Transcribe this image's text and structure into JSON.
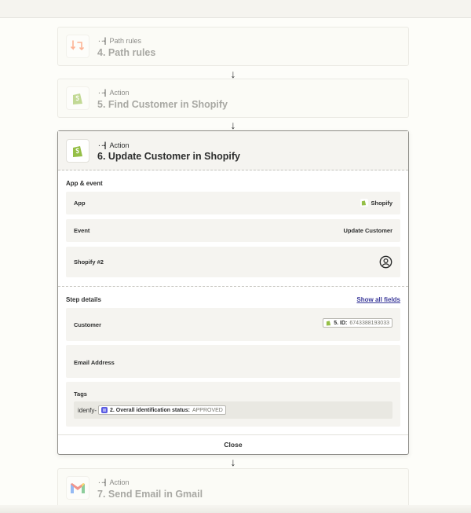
{
  "steps": {
    "path": {
      "kind": "Path rules",
      "title": "4. Path rules"
    },
    "find": {
      "kind": "Action",
      "title": "5. Find Customer in Shopify"
    },
    "update": {
      "kind": "Action",
      "title": "6. Update Customer in Shopify"
    },
    "gmail": {
      "kind": "Action",
      "title": "7. Send Email in Gmail"
    }
  },
  "card": {
    "app_event_label": "App & event",
    "app_label": "App",
    "app_value": "Shopify",
    "event_label": "Event",
    "event_value": "Update Customer",
    "account_label": "Shopify #2",
    "step_details_label": "Step details",
    "show_all_fields": "Show all fields",
    "customer_label": "Customer",
    "customer_pill_bold": "5. ID:",
    "customer_pill_value": "6743388193033",
    "email_label": "Email Address",
    "tags_label": "Tags",
    "tags_prefix": "idenfy-",
    "tags_pill_bold": "2. Overall identification status:",
    "tags_pill_value": "APPROVED",
    "close_label": "Close"
  },
  "arrow_glyph": "↓",
  "kind_glyph": "··┫",
  "icons": [
    "path-rules-icon",
    "shopify-icon",
    "gmail-icon",
    "account-icon",
    "idenfy-icon"
  ],
  "colors": {
    "accent_link": "#3b3a9a",
    "shopify_green": "#95bf47",
    "path_orange": "#ff7a45"
  }
}
